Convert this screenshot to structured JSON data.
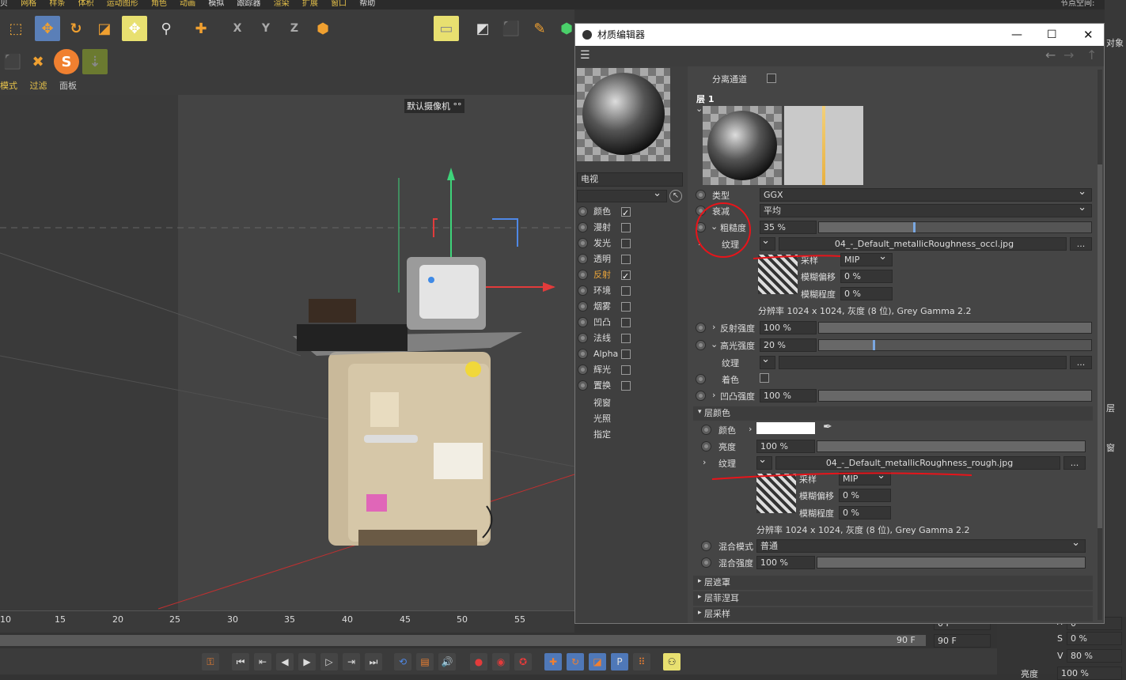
{
  "menu": {
    "items": [
      "贝",
      "网格",
      "样条",
      "体积",
      "运动图形",
      "角色",
      "动画",
      "模拟",
      "跟踪器",
      "渲染",
      "扩展",
      "窗口",
      "帮助"
    ],
    "right": "节点空间:"
  },
  "viewport": {
    "menu": [
      "模式",
      "过滤",
      "面板"
    ],
    "camera_label": "默认摄像机 °°"
  },
  "timeline": {
    "ticks": [
      "10",
      "15",
      "20",
      "25",
      "30",
      "35",
      "40",
      "45",
      "50",
      "55",
      "0"
    ],
    "end_frame": "90 F",
    "end_frame2": "90 F",
    "field1": "0 F"
  },
  "right_panel": {
    "top_label": "对象",
    "side_label": "层",
    "side_label2": "窗",
    "h_label": "H",
    "h_val": "0",
    "s_label": "S",
    "s_val": "0 %",
    "v_label": "V",
    "v_val": "80 %",
    "bright_label": "亮度",
    "bright_val": "100 %"
  },
  "dialog": {
    "title": "材质编辑器",
    "material_name": "电视",
    "channels": [
      {
        "label": "颜色",
        "checked": true
      },
      {
        "label": "漫射",
        "checked": false
      },
      {
        "label": "发光",
        "checked": false
      },
      {
        "label": "透明",
        "checked": false
      },
      {
        "label": "反射",
        "checked": true
      },
      {
        "label": "环境",
        "checked": false
      },
      {
        "label": "烟雾",
        "checked": false
      },
      {
        "label": "凹凸",
        "checked": false
      },
      {
        "label": "法线",
        "checked": false
      },
      {
        "label": "Alpha",
        "checked": false
      },
      {
        "label": "辉光",
        "checked": false
      },
      {
        "label": "置换",
        "checked": false
      }
    ],
    "extra_channels": [
      "视窗",
      "光照",
      "指定"
    ],
    "separate_pass": "分离通道",
    "layer_title": "层 1",
    "type_label": "类型",
    "type_value": "GGX",
    "attenuation_label": "衰减",
    "attenuation_value": "平均",
    "roughness_label": "粗糙度",
    "roughness_value": "35 %",
    "roughness_fraction": 0.35,
    "texture_label": "纹理",
    "texture1_file": "04_-_Default_metallicRoughness_occl.jpg",
    "sampling_label": "采样",
    "sampling_value": "MIP",
    "blur_offset_label": "模糊偏移",
    "blur_offset_value": "0 %",
    "blur_scale_label": "模糊程度",
    "blur_scale_value": "0 %",
    "res1": "分辨率 1024 x 1024, 灰度 (8 位), Grey Gamma 2.2",
    "refl_strength_label": "反射强度",
    "refl_strength_value": "100 %",
    "spec_strength_label": "高光强度",
    "spec_strength_value": "20 %",
    "spec_fraction": 0.2,
    "tint_label": "着色",
    "bump_strength_label": "凹凸强度",
    "bump_strength_value": "100 %",
    "layer_color_section": "层颜色",
    "color_label": "颜色",
    "brightness_label": "亮度",
    "brightness_value": "100 %",
    "texture2_file": "04_-_Default_metallicRoughness_rough.jpg",
    "res2": "分辨率 1024 x 1024, 灰度 (8 位), Grey Gamma 2.2",
    "blend_mode_label": "混合模式",
    "blend_mode_value": "普通",
    "blend_strength_label": "混合强度",
    "blend_strength_value": "100 %",
    "sections": [
      "层遮罩",
      "层菲涅耳",
      "层采样"
    ],
    "browse": "..."
  },
  "colors": {
    "accent": "#7aa7e0",
    "annotation": "#e8141a",
    "highlight_yellow": "#e8e070"
  }
}
